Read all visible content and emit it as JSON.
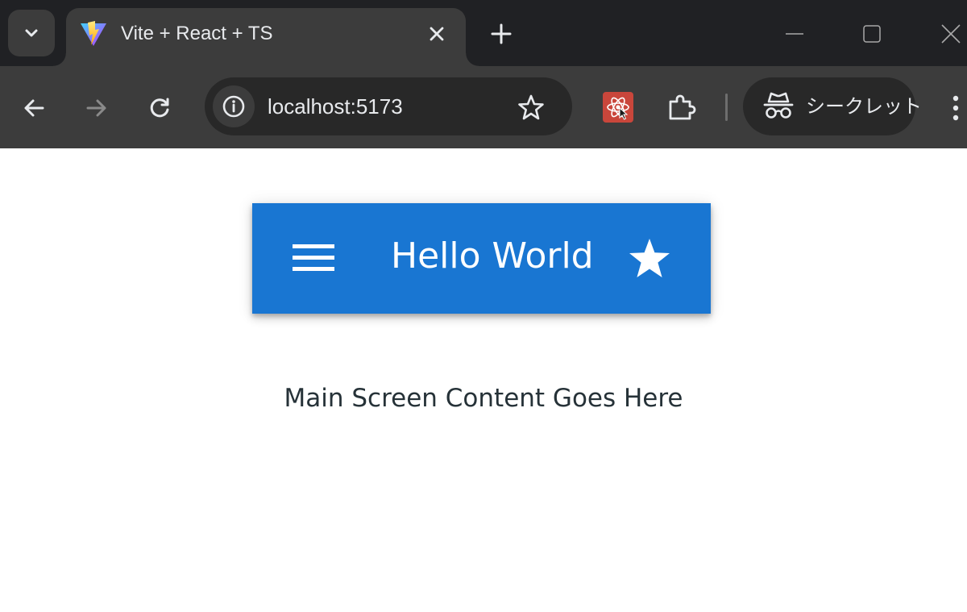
{
  "browser": {
    "tab": {
      "title": "Vite + React + TS"
    },
    "address_bar": {
      "url": "localhost:5173"
    },
    "incognito": {
      "label": "シークレット"
    }
  },
  "app_bar": {
    "title": "Hello World",
    "color": "#1976d2"
  },
  "main": {
    "content_text": "Main Screen Content Goes Here"
  },
  "icons": {
    "tab_search": "chevron-down-icon",
    "favicon": "vite-logo-icon",
    "tab_close": "close-icon",
    "new_tab": "plus-icon",
    "back": "arrow-left-icon",
    "forward": "arrow-right-icon",
    "reload": "reload-icon",
    "site_info": "info-icon",
    "bookmark": "star-outline-icon",
    "react_devtools": "react-atom-icon",
    "extensions": "puzzle-icon",
    "incognito": "incognito-icon",
    "browser_menu": "kebab-menu-icon",
    "app_menu": "hamburger-menu-icon",
    "app_favorite": "star-icon"
  }
}
